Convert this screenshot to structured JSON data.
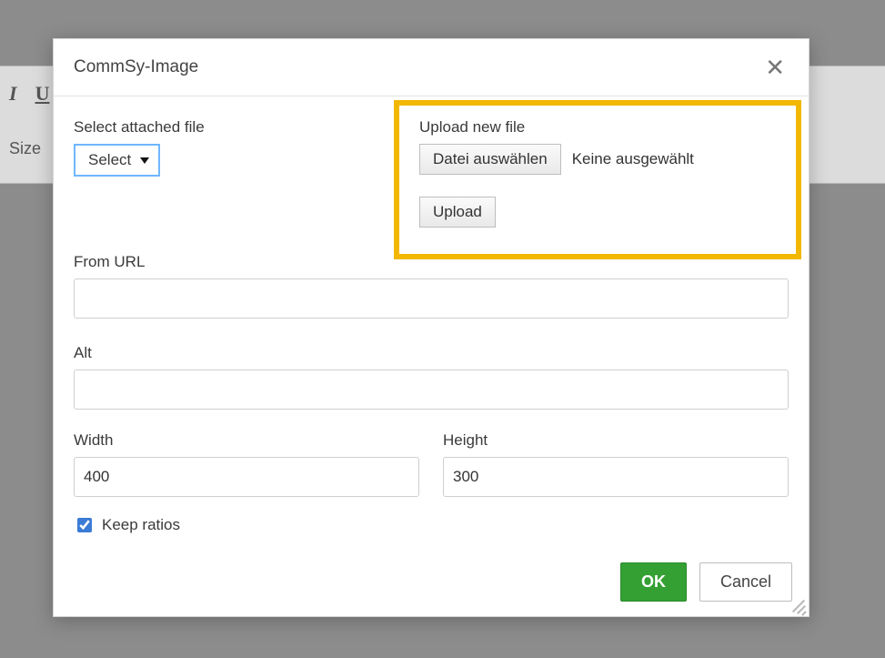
{
  "background": {
    "toolbar": {
      "italic_glyph": "I",
      "underline_glyph": "U",
      "size_label": "Size"
    }
  },
  "dialog": {
    "title": "CommSy-Image",
    "select_file": {
      "label": "Select attached file",
      "dropdown_text": "Select"
    },
    "upload": {
      "label": "Upload new file",
      "choose_button": "Datei auswählen",
      "no_file_text": "Keine ausgewählt",
      "upload_button": "Upload"
    },
    "from_url": {
      "label": "From URL",
      "value": ""
    },
    "alt": {
      "label": "Alt",
      "value": ""
    },
    "width": {
      "label": "Width",
      "value": "400"
    },
    "height": {
      "label": "Height",
      "value": "300"
    },
    "keep_ratios": {
      "label": "Keep ratios",
      "checked": true
    },
    "buttons": {
      "ok": "OK",
      "cancel": "Cancel"
    }
  }
}
